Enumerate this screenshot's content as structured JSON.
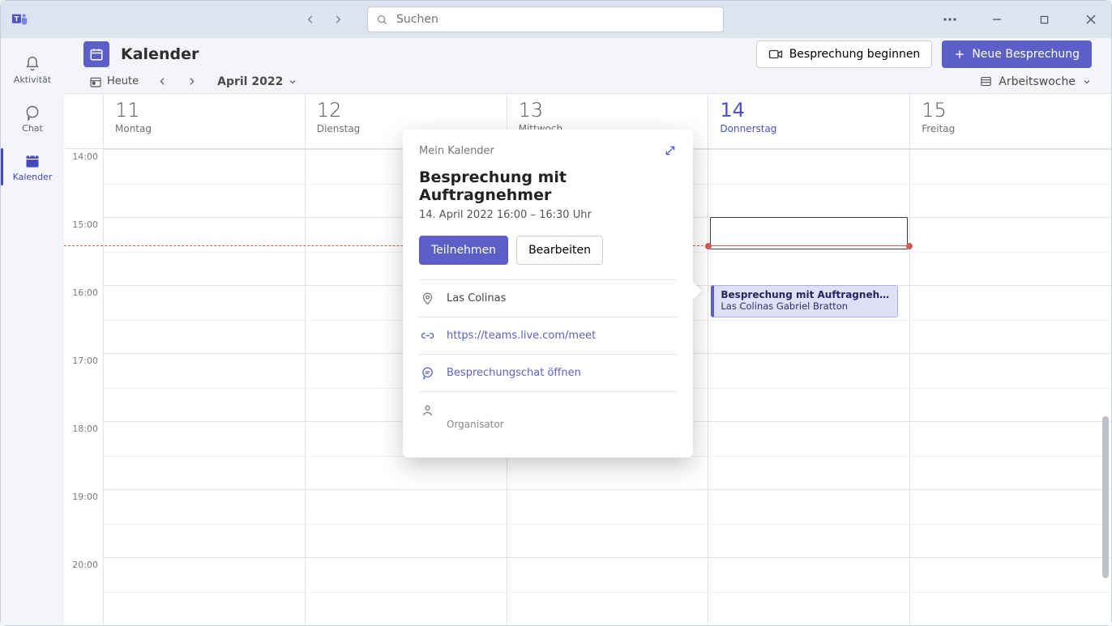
{
  "search": {
    "placeholder": "Suchen"
  },
  "rail": {
    "items": [
      {
        "id": "activity",
        "label": "Aktivität"
      },
      {
        "id": "chat",
        "label": "Chat"
      },
      {
        "id": "calendar",
        "label": "Kalender"
      }
    ],
    "active": "calendar"
  },
  "header": {
    "title": "Kalender",
    "meet_now": "Besprechung beginnen",
    "new_meeting": "Neue Besprechung"
  },
  "toolbar": {
    "today": "Heute",
    "period": "April 2022",
    "view": "Arbeitswoche"
  },
  "days": [
    {
      "num": "11",
      "name": "Montag",
      "today": false
    },
    {
      "num": "12",
      "name": "Dienstag",
      "today": false
    },
    {
      "num": "13",
      "name": "Mittwoch",
      "today": false
    },
    {
      "num": "14",
      "name": "Donnerstag",
      "today": true
    },
    {
      "num": "15",
      "name": "Freitag",
      "today": false
    }
  ],
  "hours": [
    "14:00",
    "15:00",
    "16:00",
    "17:00",
    "18:00",
    "19:00",
    "20:00"
  ],
  "now": {
    "hour_index_from_top": 1.42
  },
  "event": {
    "title": "Besprechung mit Auftragnehmer",
    "subtitle": "Las Colinas Gabriel Bratton",
    "day_index": 3,
    "start_hour_offset": 2.0,
    "duration_hours": 0.5
  },
  "popup": {
    "calendar_name": "Mein Kalender",
    "title": "Besprechung mit Auftragnehmer",
    "datetime": "14. April 2022 16:00 – 16:30 Uhr",
    "join": "Teilnehmen",
    "edit": "Bearbeiten",
    "location": "Las Colinas",
    "meeting_link": "https://teams.live.com/meet",
    "open_chat": "Besprechungschat öffnen",
    "organizer_caption": "Organisator"
  },
  "colors": {
    "accent": "#5b5fc7"
  }
}
